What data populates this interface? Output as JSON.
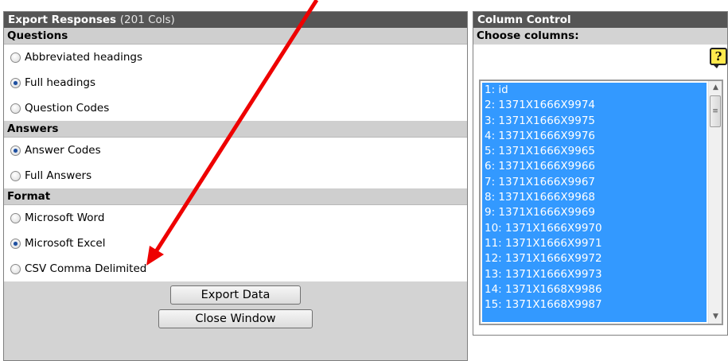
{
  "export_panel": {
    "title": "Export Responses",
    "col_count": "(201 Cols)",
    "questions": {
      "heading": "Questions",
      "options": [
        {
          "label": "Abbreviated headings",
          "checked": false
        },
        {
          "label": "Full headings",
          "checked": true
        },
        {
          "label": "Question Codes",
          "checked": false
        }
      ]
    },
    "answers": {
      "heading": "Answers",
      "options": [
        {
          "label": "Answer Codes",
          "checked": true
        },
        {
          "label": "Full Answers",
          "checked": false
        }
      ]
    },
    "format": {
      "heading": "Format",
      "options": [
        {
          "label": "Microsoft Word",
          "checked": false
        },
        {
          "label": "Microsoft Excel",
          "checked": true
        },
        {
          "label": "CSV Comma Delimited",
          "checked": false
        }
      ]
    },
    "export_button": "Export Data",
    "close_button": "Close Window"
  },
  "column_control": {
    "title": "Column Control",
    "subtitle": "Choose columns:",
    "help_icon": "?",
    "columns": [
      "1: id",
      "2: 1371X1666X9974",
      "3: 1371X1666X9975",
      "4: 1371X1666X9976",
      "5: 1371X1666X9965",
      "6: 1371X1666X9966",
      "7: 1371X1666X9967",
      "8: 1371X1666X9968",
      "9: 1371X1666X9969",
      "10: 1371X1666X9970",
      "11: 1371X1666X9971",
      "12: 1371X1666X9972",
      "13: 1371X1666X9973",
      "14: 1371X1668X9986",
      "15: 1371X1668X9987"
    ]
  },
  "colors": {
    "title_bar": "#555555",
    "section_bg": "#d3d3d3",
    "selection": "#3399ff",
    "arrow": "#ee0000"
  }
}
